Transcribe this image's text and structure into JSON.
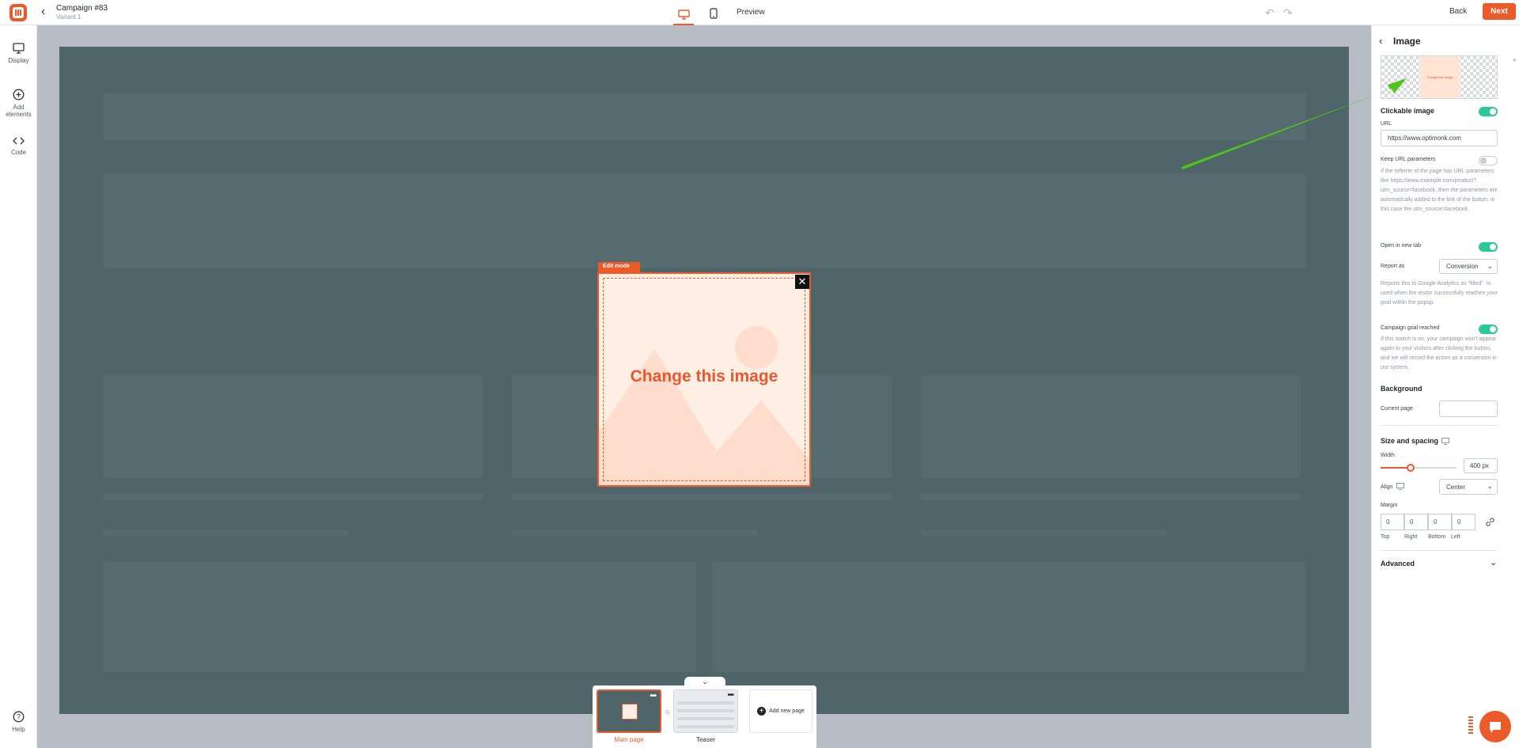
{
  "header": {
    "campaign_title": "Campaign #83",
    "variant": "Variant 1",
    "preview_label": "Preview",
    "back_label": "Back",
    "next_label": "Next"
  },
  "sidebar": {
    "items": [
      {
        "label": "Display",
        "icon": "monitor-icon"
      },
      {
        "label": "Add elements",
        "icon": "plus-circle-icon"
      },
      {
        "label": "Code",
        "icon": "code-icon"
      }
    ],
    "help_label": "Help"
  },
  "canvas": {
    "edit_mode_label": "Edit mode",
    "popup_text": "Change this image"
  },
  "pages": {
    "main_label": "Main page",
    "teaser_label": "Teaser",
    "add_label": "Add new page"
  },
  "panel": {
    "title": "Image",
    "preview_text": "Change this image",
    "clickable_image": {
      "label": "Clickable image",
      "enabled": true
    },
    "url": {
      "label": "URL",
      "value": "https://www.optimonk.com"
    },
    "keep_url_params": {
      "label": "Keep URL parameters",
      "enabled": false,
      "help": "If the referrer of the page has URL parameters like https://www.example.com/product?utm_source=facebook, then the parameters are automatically added to the link of the button, in this case the utm_source=facebook."
    },
    "open_new_tab": {
      "label": "Open in new tab",
      "enabled": true
    },
    "report_as": {
      "label": "Report as",
      "value": "Conversion",
      "help": "Reports this to Google Analytics as \"filled\". Is used when the visitor successfully reaches your goal within the popup."
    },
    "campaign_goal": {
      "label": "Campaign goal reached",
      "enabled": true,
      "help": "If this switch is on, your campaign won't appear again to your visitors after clicking the button, and we will record the action as a conversion in our system."
    },
    "background": {
      "heading": "Background",
      "current_page_label": "Current page"
    },
    "size": {
      "heading": "Size and spacing",
      "width_label": "Width",
      "width_value": "400",
      "width_unit": "px",
      "width_fraction": 0.4,
      "align_label": "Align",
      "align_value": "Center",
      "margin_label": "Margin",
      "margins": [
        {
          "label": "Top",
          "value": "0"
        },
        {
          "label": "Right",
          "value": "0"
        },
        {
          "label": "Bottom",
          "value": "0"
        },
        {
          "label": "Left",
          "value": "0"
        }
      ]
    },
    "advanced_label": "Advanced"
  },
  "colors": {
    "brand": "#ed5a29",
    "toggle_on": "#2cc898",
    "canvas_bg": "#4f6569",
    "annotation_arrow": "#4fc518"
  }
}
